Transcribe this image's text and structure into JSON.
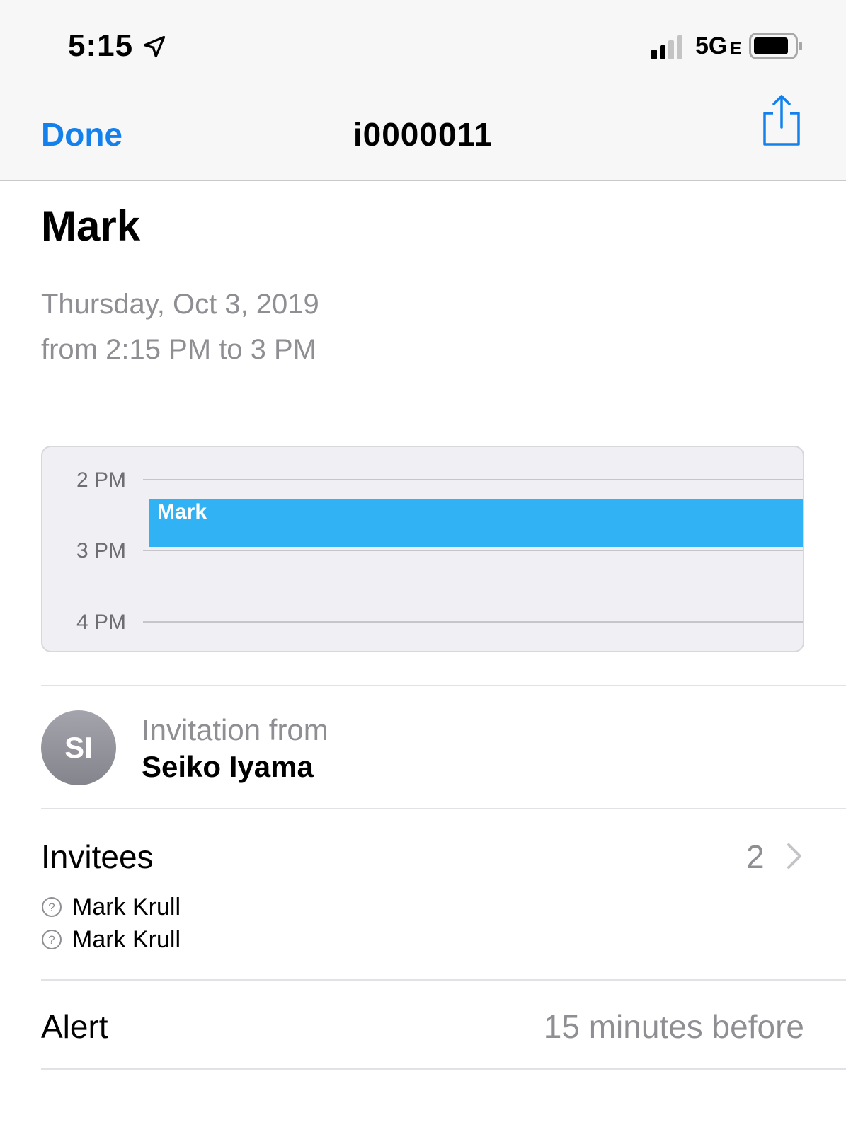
{
  "status_bar": {
    "time": "5:15",
    "network": "5G",
    "network_suffix": "E"
  },
  "nav": {
    "done_label": "Done",
    "title": "i0000011",
    "share_icon": "share-icon",
    "accent_color": "#1380ec"
  },
  "event": {
    "title": "Mark",
    "date": "Thursday, Oct 3, 2019",
    "time_range": "from 2:15 PM to 3 PM"
  },
  "calendar_preview": {
    "hours": [
      "2 PM",
      "3 PM",
      "4 PM"
    ],
    "event_label": "Mark",
    "event_color": "#31b2f4"
  },
  "invitation": {
    "avatar_initials": "SI",
    "label": "Invitation from",
    "organizer": "Seiko Iyama"
  },
  "invitees": {
    "label": "Invitees",
    "count": "2",
    "list": [
      {
        "name": "Mark Krull",
        "status_icon": "question-circle-icon"
      },
      {
        "name": "Mark Krull",
        "status_icon": "question-circle-icon"
      }
    ]
  },
  "alert": {
    "label": "Alert",
    "value": "15 minutes before"
  }
}
